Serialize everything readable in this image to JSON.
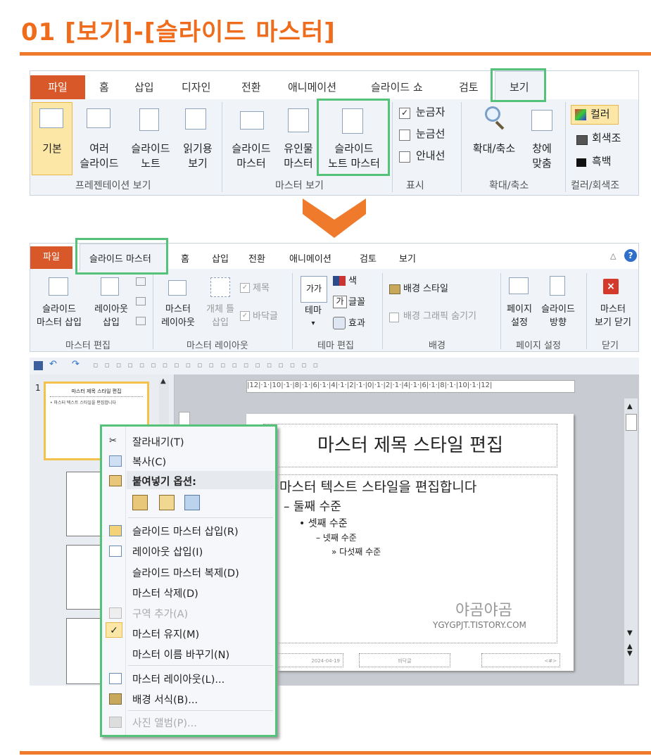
{
  "page_title": "01 [보기]-[슬라이드 마스터]",
  "ribbon1": {
    "tabs": [
      "파일",
      "홈",
      "삽입",
      "디자인",
      "전환",
      "애니메이션",
      "슬라이드 쇼",
      "검토",
      "보기"
    ],
    "buttons": {
      "basic": "기본",
      "multi1": "여러",
      "multi2": "슬라이드",
      "notes1": "슬라이드",
      "notes2": "노트",
      "read1": "읽기용",
      "read2": "보기",
      "slidemaster1": "슬라이드",
      "slidemaster2": "마스터",
      "handout1": "유인물",
      "handout2": "마스터",
      "notesmaster1": "슬라이드",
      "notesmaster2": "노트 마스터",
      "ruler": "눈금자",
      "gridlines": "눈금선",
      "guides": "안내선",
      "zoom": "확대/축소",
      "fit1": "창에",
      "fit2": "맞춤",
      "color": "컬러",
      "grayscale": "회색조",
      "bw": "흑백"
    },
    "groups": [
      "프레젠테이션 보기",
      "마스터 보기",
      "표시",
      "확대/축소",
      "컬러/회색조"
    ]
  },
  "ribbon2": {
    "tabs": [
      "파일",
      "슬라이드 마스터",
      "홈",
      "삽입",
      "전환",
      "애니메이션",
      "검토",
      "보기"
    ],
    "buttons": {
      "insert_master1": "슬라이드",
      "insert_master2": "마스터 삽입",
      "insert_layout1": "레이아웃",
      "insert_layout2": "삽입",
      "master_layout1": "마스터",
      "master_layout2": "레이아웃",
      "placeholder1": "개체 틀",
      "placeholder2": "삽입",
      "title_chk": "제목",
      "footer_chk": "바닥글",
      "theme": "테마",
      "colors": "색",
      "fonts": "글꼴",
      "effects": "효과",
      "bg_styles": "배경 스타일",
      "hide_bg": "배경 그래픽 숨기기",
      "page_setup1": "페이지",
      "page_setup2": "설정",
      "orientation1": "슬라이드",
      "orientation2": "방향",
      "close1": "마스터",
      "close2": "보기 닫기",
      "theme_glyph": "가가",
      "font_glyph": "가"
    },
    "groups": [
      "마스터 편집",
      "마스터 레이아웃",
      "테마 편집",
      "배경",
      "페이지 설정",
      "닫기"
    ]
  },
  "slide": {
    "thumb_number": "1",
    "thumb_title": "마스터 제목 스타일 편집",
    "thumb_text": "• 마스터 텍스트 스타일을 편집합니다",
    "title": "마스터 제목 스타일 편집",
    "level1": "마스터 텍스트 스타일을 편집합니다",
    "level2": "둘째 수준",
    "level3": "셋째 수준",
    "level4": "넷째 수준",
    "level5": "다섯째 수준",
    "date": "2024-04-19",
    "footer": "바닥글",
    "page": "<#>",
    "watermark": "야곰야곰",
    "watermark_url": "YGYGPJT.TISTORY.COM",
    "ruler": "|12|·1·|10|·1·|8|·1·|6|·1·|4|·1·|2|·1·|0|·1·|2|·1·|4|·1·|6|·1·|8|·1·|10|·1·|12|"
  },
  "context_menu": {
    "cut": "잘라내기(T)",
    "copy": "복사(C)",
    "paste_options": "붙여넣기 옵션:",
    "insert_master": "슬라이드 마스터 삽입(R)",
    "insert_layout": "레이아웃 삽입(I)",
    "duplicate_master": "슬라이드 마스터 복제(D)",
    "delete_master": "마스터 삭제(D)",
    "add_section": "구역 추가(A)",
    "preserve": "마스터 유지(M)",
    "rename": "마스터 이름 바꾸기(N)",
    "master_layout": "마스터 레이아웃(L)...",
    "format_bg": "배경 서식(B)...",
    "photo_album": "사진 앨범(P)..."
  },
  "colors": {
    "accent": "#ef7a2c",
    "highlight": "#55c27a",
    "file_tab": "#d9582a"
  }
}
